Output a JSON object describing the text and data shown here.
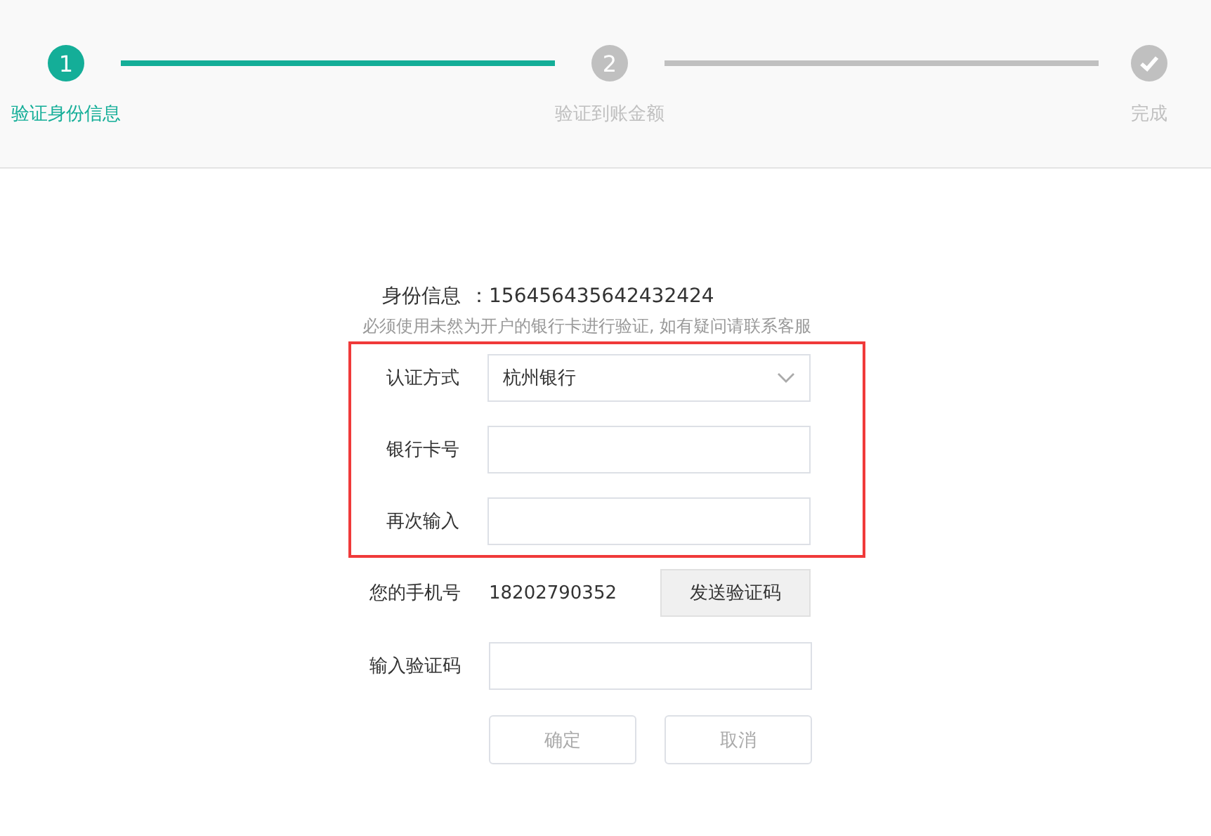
{
  "steps": [
    {
      "kind": "number",
      "number": "1",
      "label": "验证身份信息",
      "active": true
    },
    {
      "kind": "number",
      "number": "2",
      "label": "验证到账金额",
      "active": false
    },
    {
      "kind": "check",
      "label": "完成",
      "active": false
    }
  ],
  "connectors": [
    {
      "active": true
    },
    {
      "active": false
    }
  ],
  "identity": {
    "label": "身份信息",
    "value": "：156456435642432424"
  },
  "hint": "必须使用未然为开户的银行卡进行验证, 如有疑问请联系客服",
  "highlighted_fields": [
    {
      "kind": "select",
      "label": "认证方式",
      "value": "杭州银行"
    },
    {
      "kind": "input",
      "label": "银行卡号"
    },
    {
      "kind": "input",
      "label": "再次输入"
    }
  ],
  "phone": {
    "label": "您的手机号",
    "value": "18202790352",
    "button": "发送验证码"
  },
  "code_field": {
    "label": "输入验证码"
  },
  "buttons": [
    {
      "label": "确定"
    },
    {
      "label": "取消"
    }
  ]
}
